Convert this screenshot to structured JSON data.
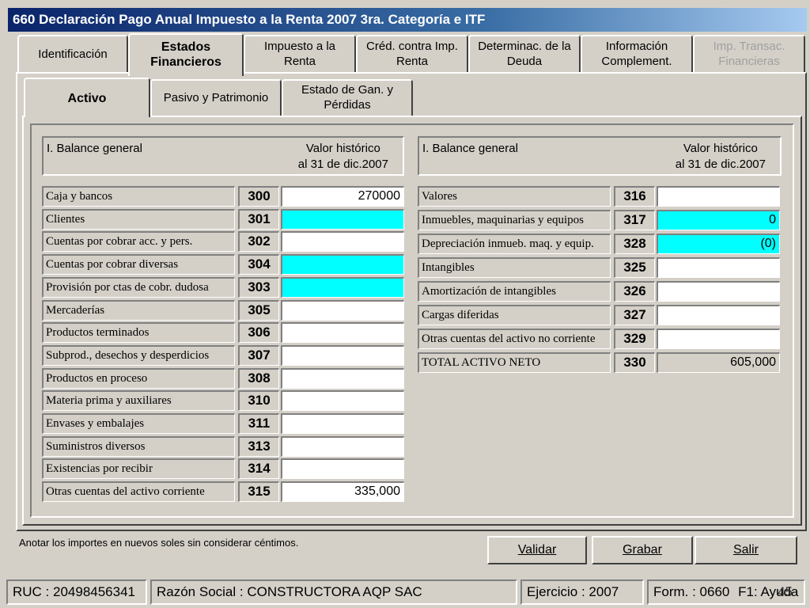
{
  "window": {
    "title": "660 Declaración Pago Anual Impuesto a la Renta 2007 3ra. Categoría e ITF"
  },
  "tabs": [
    {
      "line1": "Identificación",
      "line2": ""
    },
    {
      "line1": "Estados",
      "line2": "Financieros"
    },
    {
      "line1": "Impuesto a  la",
      "line2": "Renta"
    },
    {
      "line1": "Créd. contra Imp.",
      "line2": "Renta"
    },
    {
      "line1": "Determinac. de la",
      "line2": "Deuda"
    },
    {
      "line1": "Información",
      "line2": "Complement."
    },
    {
      "line1": "Imp. Transac.",
      "line2": "Financieras"
    }
  ],
  "subtabs": [
    {
      "line1": "Activo",
      "line2": ""
    },
    {
      "line1": "Pasivo y Patrimonio",
      "line2": ""
    },
    {
      "line1": "Estado de Gan. y",
      "line2": "Pérdidas"
    }
  ],
  "left": {
    "header_label": "I. Balance general",
    "header_value_line1": "Valor histórico",
    "header_value_line2": "al 31 de dic.2007",
    "rows": [
      {
        "label": "Caja y bancos",
        "code": "300",
        "value": "270000",
        "style": "white"
      },
      {
        "label": "Clientes",
        "code": "301",
        "value": "",
        "style": "cyan"
      },
      {
        "label": "Cuentas por cobrar acc. y pers.",
        "code": "302",
        "value": "",
        "style": "white"
      },
      {
        "label": "Cuentas por cobrar diversas",
        "code": "304",
        "value": "",
        "style": "cyan"
      },
      {
        "label": "Provisión por ctas de cobr. dudosa",
        "code": "303",
        "value": "",
        "style": "cyan"
      },
      {
        "label": "Mercaderías",
        "code": "305",
        "value": "",
        "style": "white"
      },
      {
        "label": "Productos terminados",
        "code": "306",
        "value": "",
        "style": "white"
      },
      {
        "label": "Subprod., desechos y desperdicios",
        "code": "307",
        "value": "",
        "style": "white"
      },
      {
        "label": "Productos en proceso",
        "code": "308",
        "value": "",
        "style": "white"
      },
      {
        "label": "Materia prima y auxiliares",
        "code": "310",
        "value": "",
        "style": "white"
      },
      {
        "label": "Envases y embalajes",
        "code": "311",
        "value": "",
        "style": "white"
      },
      {
        "label": "Suministros diversos",
        "code": "313",
        "value": "",
        "style": "white"
      },
      {
        "label": "Existencias por recibir",
        "code": "314",
        "value": "",
        "style": "white"
      },
      {
        "label": "Otras cuentas del activo corriente",
        "code": "315",
        "value": "335,000",
        "style": "white"
      }
    ]
  },
  "right": {
    "header_label": "I. Balance general",
    "header_value_line1": "Valor histórico",
    "header_value_line2": "al 31 de dic.2007",
    "rows": [
      {
        "label": "Valores",
        "code": "316",
        "value": "",
        "style": "white"
      },
      {
        "label": "Inmuebles, maquinarias y equipos",
        "code": "317",
        "value": "0",
        "style": "cyan"
      },
      {
        "label": "Depreciación inmueb. maq. y equip.",
        "code": "328",
        "value": "(0)",
        "style": "cyan"
      },
      {
        "label": "Intangibles",
        "code": "325",
        "value": "",
        "style": "white"
      },
      {
        "label": "Amortización de intangibles",
        "code": "326",
        "value": "",
        "style": "white"
      },
      {
        "label": "Cargas diferidas",
        "code": "327",
        "value": "",
        "style": "white"
      },
      {
        "label": "Otras cuentas del activo no corriente",
        "code": "329",
        "value": "",
        "style": "white"
      },
      {
        "label": "TOTAL ACTIVO NETO",
        "code": "330",
        "value": "605,000",
        "style": "readonly"
      }
    ]
  },
  "footer": {
    "hint": "Anotar los importes en nuevos soles sin considerar céntimos.",
    "validar": "Validar",
    "grabar": "Grabar",
    "salir": "Salir"
  },
  "status": {
    "ruc": "RUC : 20498456341",
    "razon": "Razón Social : CONSTRUCTORA AQP SAC",
    "ejercicio": "Ejercicio : 2007",
    "form": "Form. : 0660",
    "ayuda": "F1: Ayuda",
    "page_number": "45"
  }
}
